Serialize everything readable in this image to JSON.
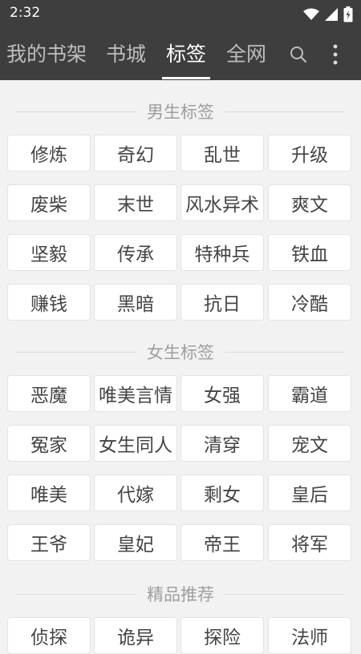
{
  "status_bar": {
    "time": "2:32",
    "icons": [
      "wifi-icon",
      "signal-icon",
      "battery-icon"
    ]
  },
  "tabs": [
    {
      "label": "我的书架",
      "active": false
    },
    {
      "label": "书城",
      "active": false
    },
    {
      "label": "标签",
      "active": true
    },
    {
      "label": "全网",
      "active": false
    }
  ],
  "toolbar_icons": [
    "search-icon",
    "more-vert-icon"
  ],
  "colors": {
    "appbar": "#3e3e3e",
    "background": "#f2f2f2",
    "tag_background": "#ffffff",
    "tag_text": "#444444",
    "section_title": "#9e9e9e"
  },
  "sections": [
    {
      "title": "男生标签",
      "tags": [
        "修炼",
        "奇幻",
        "乱世",
        "升级",
        "废柴",
        "末世",
        "风水异术",
        "爽文",
        "坚毅",
        "传承",
        "特种兵",
        "铁血",
        "赚钱",
        "黑暗",
        "抗日",
        "冷酷"
      ]
    },
    {
      "title": "女生标签",
      "tags": [
        "恶魔",
        "唯美言情",
        "女强",
        "霸道",
        "冤家",
        "女生同人",
        "清穿",
        "宠文",
        "唯美",
        "代嫁",
        "剩女",
        "皇后",
        "王爷",
        "皇妃",
        "帝王",
        "将军"
      ]
    },
    {
      "title": "精品推荐",
      "tags": [
        "侦探",
        "诡异",
        "探险",
        "法师"
      ]
    }
  ]
}
